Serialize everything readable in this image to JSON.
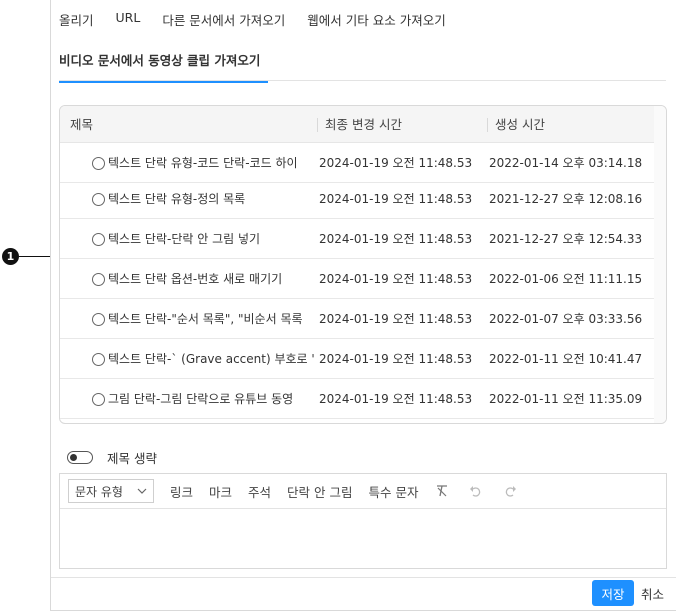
{
  "tabs": [
    "올리기",
    "URL",
    "다른 문서에서 가져오기",
    "웹에서 기타 요소 가져오기"
  ],
  "subtab": "비디오 문서에서 동영상 클립 가져오기",
  "table": {
    "headers": [
      "제목",
      "최종 변경 시간",
      "생성 시간"
    ],
    "rows": [
      {
        "title": "텍스트 단락 유형-코드 단락-코드 하이",
        "modified": "2024-01-19 오전 11:48.53",
        "created": "2022-01-14 오후 03:14.18"
      },
      {
        "title": "텍스트 단락 유형-정의 목록",
        "modified": "2024-01-19 오전 11:48.53",
        "created": "2021-12-27 오후 12:08.16"
      },
      {
        "title": "텍스트 단락-단락 안 그림 넣기",
        "modified": "2024-01-19 오전 11:48.53",
        "created": "2021-12-27 오후 12:54.33"
      },
      {
        "title": "텍스트 단락 옵션-번호 새로 매기기",
        "modified": "2024-01-19 오전 11:48.53",
        "created": "2022-01-06 오전 11:11.15"
      },
      {
        "title": "텍스트 단락-\"순서 목록\", \"비순서 목록",
        "modified": "2024-01-19 오전 11:48.53",
        "created": "2022-01-07 오후 03:33.56"
      },
      {
        "title": "텍스트 단락-` (Grave accent) 부호로 '",
        "modified": "2024-01-19 오전 11:48.53",
        "created": "2022-01-11 오전 10:41.47"
      },
      {
        "title": "그림 단락-그림 단락으로 유튜브 동영",
        "modified": "2024-01-19 오전 11:48.53",
        "created": "2022-01-11 오전 11:35.09"
      }
    ]
  },
  "callout": "1",
  "toggle_label": "제목 생략",
  "editor": {
    "select_value": "문자 유형",
    "tools": [
      "링크",
      "마크",
      "주석",
      "단락 안 그림",
      "특수 문자"
    ]
  },
  "footer": {
    "save": "저장",
    "cancel": "취소"
  }
}
